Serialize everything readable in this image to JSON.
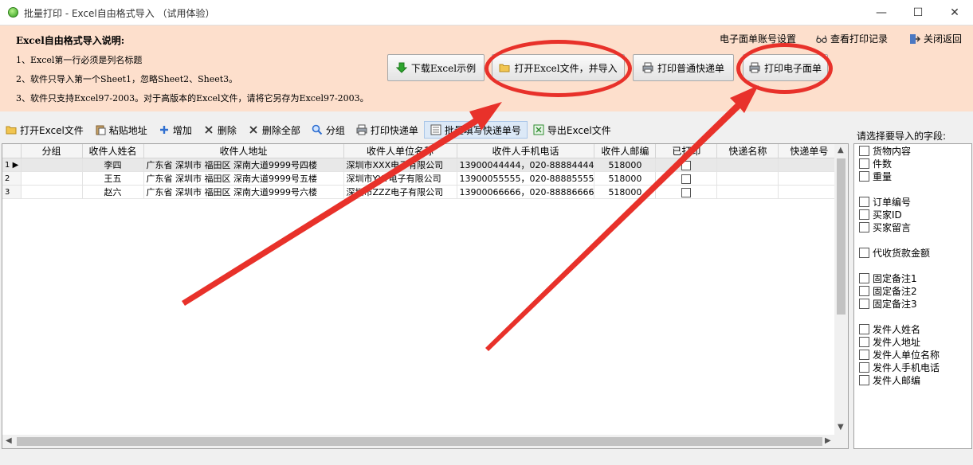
{
  "window": {
    "title": "批量打印 - Excel自由格式导入 （试用体验）",
    "minimize": "—",
    "maximize": "☐",
    "close": "✕"
  },
  "instructions": {
    "title": "Excel自由格式导入说明:",
    "lines": [
      "1、Excel第一行必须是列名标题",
      "2、软件只导入第一个Sheet1，忽略Sheet2、Sheet3。",
      "3、软件只支持Excel97-2003。对于高版本的Excel文件，请将它另存为Excel97-2003。"
    ]
  },
  "top_links": {
    "account": "电子面单账号设置",
    "history": "查看打印记录",
    "close_back": "关闭返回"
  },
  "buttons": {
    "download_sample": "下载Excel示例",
    "open_import": "打开Excel文件，并导入",
    "print_normal": "打印普通快递单",
    "print_electronic": "打印电子面单"
  },
  "toolbar": {
    "open": "打开Excel文件",
    "paste": "粘贴地址",
    "add": "增加",
    "delete": "删除",
    "delete_all": "删除全部",
    "group": "分组",
    "print": "打印快递单",
    "batch_fill": "批量填写快递单号",
    "export": "导出Excel文件"
  },
  "grid": {
    "columns": [
      "分组",
      "收件人姓名",
      "收件人地址",
      "收件人单位名称",
      "收件人手机电话",
      "收件人邮编",
      "已打印",
      "快递名称",
      "快递单号"
    ],
    "rows": [
      {
        "num": "1",
        "group": "",
        "name": "李四",
        "address": "广东省  深圳市  福田区  深南大道9999号四楼",
        "company": "深圳市XXX电子有限公司",
        "phone": "13900044444，020-88884444",
        "zip": "518000",
        "printed": false,
        "express": "",
        "tracking": ""
      },
      {
        "num": "2",
        "group": "",
        "name": "王五",
        "address": "广东省  深圳市  福田区  深南大道9999号五楼",
        "company": "深圳市YYY电子有限公司",
        "phone": "13900055555，020-88885555",
        "zip": "518000",
        "printed": false,
        "express": "",
        "tracking": ""
      },
      {
        "num": "3",
        "group": "",
        "name": "赵六",
        "address": "广东省  深圳市  福田区  深南大道9999号六楼",
        "company": "深圳市ZZZ电子有限公司",
        "phone": "13900066666，020-88886666",
        "zip": "518000",
        "printed": false,
        "express": "",
        "tracking": ""
      }
    ]
  },
  "fields_panel": {
    "label": "请选择要导入的字段:",
    "fields": [
      "货物内容",
      "件数",
      "重量",
      "订单编号",
      "买家ID",
      "买家留言",
      "代收货款金额",
      "固定备注1",
      "固定备注2",
      "固定备注3",
      "发件人姓名",
      "发件人地址",
      "发件人单位名称",
      "发件人手机电话",
      "发件人邮编"
    ]
  },
  "colors": {
    "header_bg": "#fddfcc",
    "annotation_red": "#e8312a",
    "selected_row": "#e8e8e8"
  }
}
